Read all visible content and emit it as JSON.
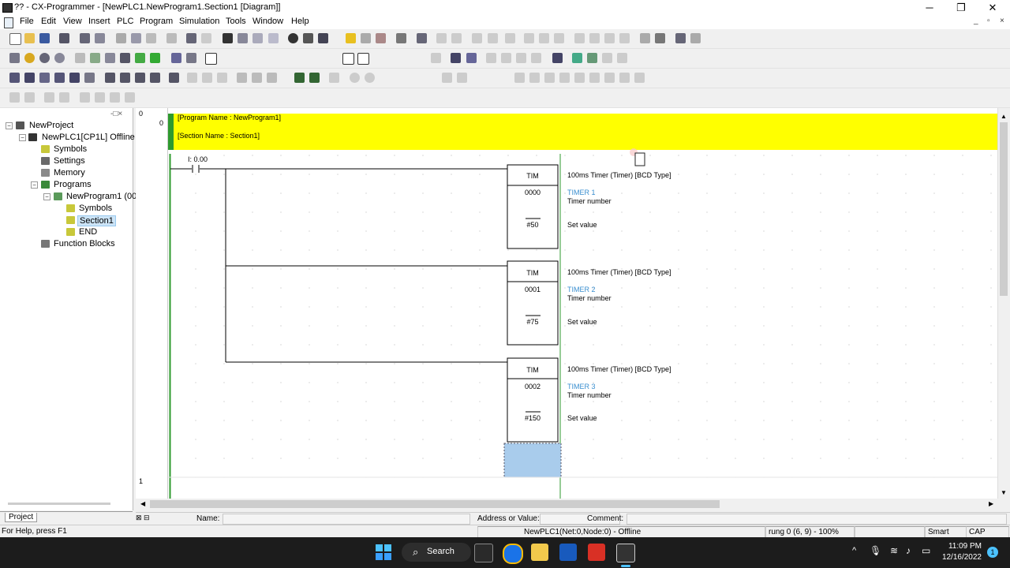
{
  "window": {
    "title": "?? - CX-Programmer - [NewPLC1.NewProgram1.Section1 [Diagram]]",
    "controls": {
      "minimize": "─",
      "maximize": "❐",
      "close": "✕"
    }
  },
  "menu": {
    "items": [
      "File",
      "Edit",
      "View",
      "Insert",
      "PLC",
      "Program",
      "Simulation",
      "Tools",
      "Window",
      "Help"
    ],
    "mdi": {
      "minimize": "_",
      "restore": "▫",
      "close": "×"
    }
  },
  "project_tree": {
    "items": [
      {
        "label": "NewProject",
        "icon": "project-icon",
        "color": "#555555"
      },
      {
        "label": "NewPLC1[CP1L] Offline",
        "icon": "plc-icon",
        "color": "#333333"
      },
      {
        "label": "Symbols",
        "icon": "symbols-icon",
        "color": "#c8c83a"
      },
      {
        "label": "Settings",
        "icon": "settings-icon",
        "color": "#6a6a6a"
      },
      {
        "label": "Memory",
        "icon": "memory-icon",
        "color": "#8a8a8a"
      },
      {
        "label": "Programs",
        "icon": "programs-icon",
        "color": "#3a8a3a"
      },
      {
        "label": "NewProgram1 (00",
        "icon": "program-icon",
        "color": "#5a9a5a"
      },
      {
        "label": "Symbols",
        "icon": "symbols-icon",
        "color": "#c8c83a"
      },
      {
        "label": "Section1",
        "icon": "section-icon",
        "color": "#c8c83a"
      },
      {
        "label": "END",
        "icon": "end-icon",
        "color": "#c8c83a"
      },
      {
        "label": "Function Blocks",
        "icon": "function-blocks-icon",
        "color": "#777777"
      }
    ],
    "tab_label": "Project"
  },
  "rung_numbers": {
    "rung0": "0",
    "rung0_step": "0",
    "rung1": "1"
  },
  "program_header": {
    "program_name": "[Program Name : NewProgram1]",
    "section_name": "[Section Name : Section1]",
    "bg_color": "#ffff00"
  },
  "contact": {
    "address": "I: 0.00"
  },
  "timers": [
    {
      "instr": "TIM",
      "number": "0000",
      "setval": "#50",
      "desc": "100ms Timer (Timer) [BCD Type]",
      "symbol": "TIMER 1",
      "op1_label": "Timer number",
      "op2_label": "Set value"
    },
    {
      "instr": "TIM",
      "number": "0001",
      "setval": "#75",
      "desc": "100ms Timer (Timer) [BCD Type]",
      "symbol": "TIMER 2",
      "op1_label": "Timer number",
      "op2_label": "Set value"
    },
    {
      "instr": "TIM",
      "number": "0002",
      "setval": "#150",
      "desc": "100ms Timer (Timer) [BCD Type]",
      "symbol": "TIMER 3",
      "op1_label": "Timer number",
      "op2_label": "Set value"
    }
  ],
  "info_bar": {
    "name_label": "Name:",
    "address_label": "Address or Value:",
    "comment_label": "Comment:"
  },
  "status_bar": {
    "help": "For Help, press F1",
    "plc": "NewPLC1(Net:0,Node:0) - Offline",
    "position": "rung 0 (6, 9)  - 100%",
    "mode": "Smart",
    "caps": "CAP"
  },
  "taskbar": {
    "search_label": "Search",
    "time": "11:09 PM",
    "date": "12/16/2022",
    "notification_count": "1"
  }
}
